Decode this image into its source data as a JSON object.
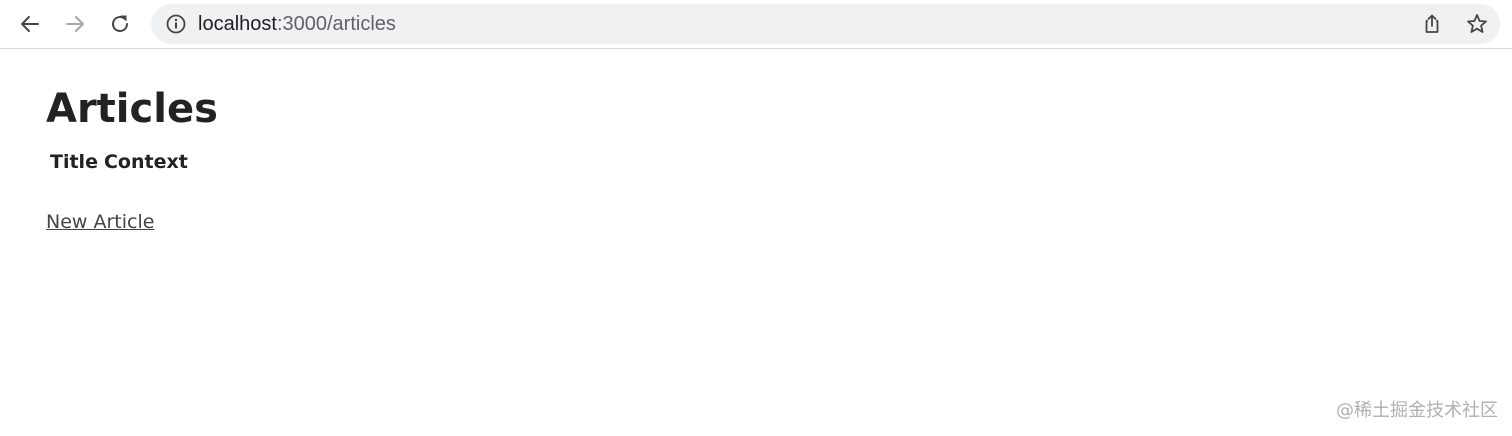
{
  "browser": {
    "url_host": "localhost",
    "url_path": ":3000/articles",
    "icons": {
      "back": "arrow-left-icon",
      "forward": "arrow-right-icon",
      "reload": "reload-icon",
      "info": "info-icon",
      "share": "share-icon",
      "bookmark": "star-icon"
    }
  },
  "page": {
    "title": "Articles",
    "table_headers": [
      "Title",
      "Context"
    ],
    "new_article_link": "New Article"
  },
  "watermark": "@稀土掘金技术社区",
  "colors": {
    "toolbar_bg": "#ffffff",
    "omnibox_bg": "#eff1f3",
    "text": "#222222",
    "link": "#444444"
  }
}
